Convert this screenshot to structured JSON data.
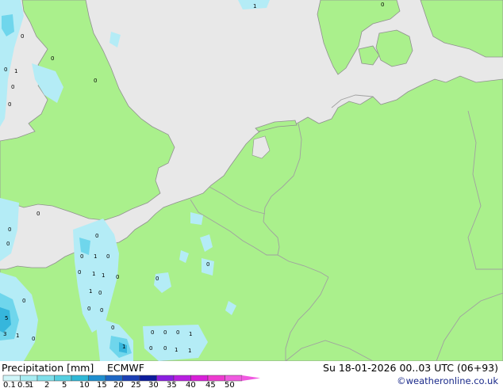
{
  "footer": {
    "title": "Precipitation [mm]",
    "model": "ECMWF",
    "datetime": "Su 18-01-2026 00..03 UTC (06+93)",
    "credit": "©weatheronline.co.uk"
  },
  "legend": {
    "ticks": [
      "0.1",
      "0.5",
      "1",
      "2",
      "5",
      "10",
      "15",
      "20",
      "25",
      "30",
      "35",
      "40",
      "45",
      "50"
    ],
    "colors": [
      "#cff5f8",
      "#a8ecf2",
      "#7fdfea",
      "#55cfe0",
      "#2fb8d6",
      "#1f8fcf",
      "#1d66c4",
      "#1c3fb5",
      "#0c1c9c",
      "#8a1fe0",
      "#b81fe0",
      "#d81fd8",
      "#ee3ad0",
      "#f05ae0"
    ]
  },
  "map": {
    "sea_color": "#e8e8e8",
    "land_color": "#aaf08c",
    "border_color": "#a0a0a0",
    "coast_color": "#909090",
    "rain_light_color": "#b4ecf6",
    "rain_mid_color": "#6fd6ec",
    "rain_heavy_color": "#36b6dc",
    "amount_labels": [
      "1",
      "0",
      "0",
      "0",
      "0",
      "1",
      "0",
      "0",
      "0",
      "0",
      "0",
      "0",
      "1",
      "0",
      "0",
      "1",
      "0",
      "0",
      "1",
      "0",
      "0",
      "1",
      "0",
      "0",
      "0",
      "0",
      "0",
      "5",
      "3",
      "1",
      "0",
      "1",
      "1",
      "0",
      "0",
      "0",
      "0",
      "1",
      "1",
      "0",
      "0"
    ]
  }
}
